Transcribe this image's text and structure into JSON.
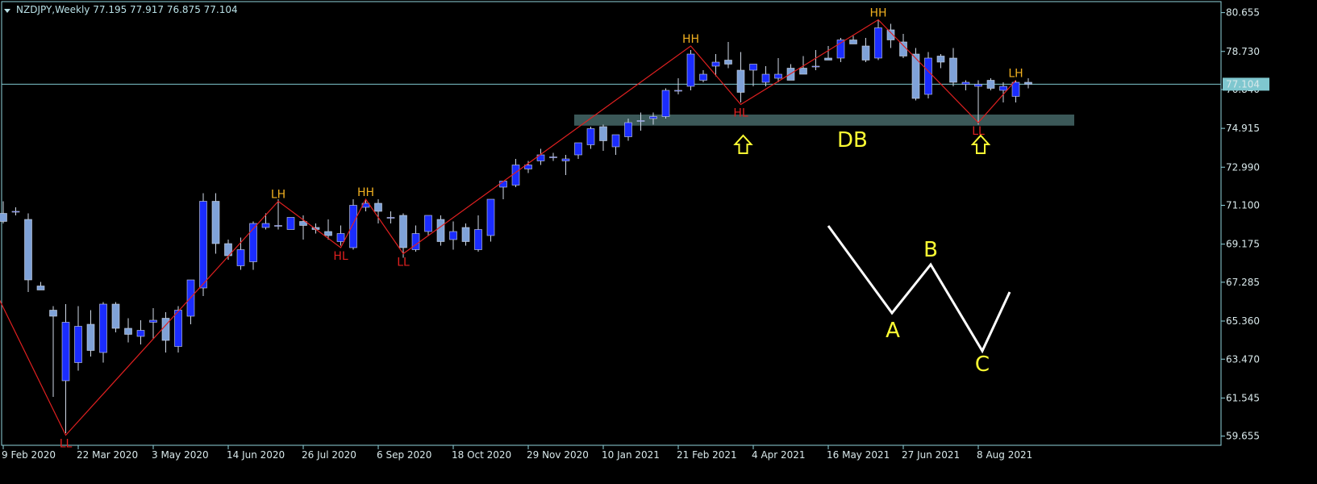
{
  "header": {
    "symbol": "NZDJPY,Weekly",
    "ohlc": "77.195 77.917 76.875 77.104"
  },
  "colors": {
    "background": "#000000",
    "bull_candle": "#1a2cff",
    "bear_candle": "#7fa2d8",
    "zigzag": "#e02020",
    "zone": "#3b5858",
    "axis": "#8fd3dd",
    "price_line": "#7fc7cf",
    "label_high": "#f0b020",
    "label_low": "#e02020",
    "pattern": "#ffffff",
    "annotation": "#ffff33"
  },
  "chart_data": {
    "type": "candlestick",
    "title": "NZDJPY,Weekly",
    "timeframe": "Weekly",
    "current_price": "77.104",
    "ylim": [
      59.2,
      81.2
    ],
    "y_ticks": [
      "80.655",
      "78.730",
      "76.840",
      "74.915",
      "72.990",
      "71.100",
      "69.175",
      "67.285",
      "65.360",
      "63.470",
      "61.545",
      "59.655"
    ],
    "x_ticks": [
      "9 Feb 2020",
      "22 Mar 2020",
      "3 May 2020",
      "14 Jun 2020",
      "26 Jul 2020",
      "6 Sep 2020",
      "18 Oct 2020",
      "29 Nov 2020",
      "10 Jan 2021",
      "21 Feb 2021",
      "4 Apr 2021",
      "16 May 2021",
      "27 Jun 2021",
      "8 Aug 2021"
    ],
    "candles": [
      {
        "o": 70.7,
        "h": 71.3,
        "l": 70.2,
        "c": 70.3
      },
      {
        "o": 70.8,
        "h": 71.0,
        "l": 70.6,
        "c": 70.8
      },
      {
        "o": 70.4,
        "h": 70.7,
        "l": 66.8,
        "c": 67.4
      },
      {
        "o": 67.1,
        "h": 67.3,
        "l": 66.9,
        "c": 66.9
      },
      {
        "o": 65.9,
        "h": 66.1,
        "l": 61.6,
        "c": 65.6
      },
      {
        "o": 62.4,
        "h": 66.2,
        "l": 59.8,
        "c": 65.3
      },
      {
        "o": 63.3,
        "h": 66.1,
        "l": 62.9,
        "c": 65.1
      },
      {
        "o": 65.2,
        "h": 65.9,
        "l": 63.6,
        "c": 63.9
      },
      {
        "o": 63.8,
        "h": 66.3,
        "l": 63.3,
        "c": 66.2
      },
      {
        "o": 66.2,
        "h": 66.3,
        "l": 64.8,
        "c": 65.0
      },
      {
        "o": 65.0,
        "h": 65.5,
        "l": 64.3,
        "c": 64.7
      },
      {
        "o": 64.6,
        "h": 65.4,
        "l": 64.2,
        "c": 64.9
      },
      {
        "o": 65.3,
        "h": 66.0,
        "l": 64.5,
        "c": 65.4
      },
      {
        "o": 65.5,
        "h": 65.8,
        "l": 63.8,
        "c": 64.4
      },
      {
        "o": 64.1,
        "h": 66.1,
        "l": 63.8,
        "c": 65.9
      },
      {
        "o": 65.6,
        "h": 67.4,
        "l": 65.2,
        "c": 67.4
      },
      {
        "o": 67.0,
        "h": 71.7,
        "l": 66.6,
        "c": 71.3
      },
      {
        "o": 71.3,
        "h": 71.7,
        "l": 68.7,
        "c": 69.2
      },
      {
        "o": 69.2,
        "h": 69.4,
        "l": 68.4,
        "c": 68.6
      },
      {
        "o": 68.1,
        "h": 69.5,
        "l": 67.9,
        "c": 68.9
      },
      {
        "o": 68.3,
        "h": 70.3,
        "l": 67.9,
        "c": 70.2
      },
      {
        "o": 70.0,
        "h": 70.7,
        "l": 69.9,
        "c": 70.2
      },
      {
        "o": 70.1,
        "h": 71.4,
        "l": 69.9,
        "c": 70.1
      },
      {
        "o": 69.9,
        "h": 70.5,
        "l": 69.9,
        "c": 70.5
      },
      {
        "o": 70.3,
        "h": 70.6,
        "l": 69.4,
        "c": 70.1
      },
      {
        "o": 70.0,
        "h": 70.2,
        "l": 69.7,
        "c": 69.9
      },
      {
        "o": 69.8,
        "h": 70.4,
        "l": 69.4,
        "c": 69.6
      },
      {
        "o": 69.3,
        "h": 70.1,
        "l": 69.1,
        "c": 69.7
      },
      {
        "o": 69.0,
        "h": 71.4,
        "l": 68.9,
        "c": 71.1
      },
      {
        "o": 71.0,
        "h": 71.4,
        "l": 70.8,
        "c": 71.2
      },
      {
        "o": 71.2,
        "h": 71.4,
        "l": 70.2,
        "c": 70.8
      },
      {
        "o": 70.5,
        "h": 70.8,
        "l": 70.2,
        "c": 70.5
      },
      {
        "o": 70.6,
        "h": 70.7,
        "l": 68.5,
        "c": 69.0
      },
      {
        "o": 68.9,
        "h": 70.1,
        "l": 68.8,
        "c": 69.7
      },
      {
        "o": 69.8,
        "h": 70.6,
        "l": 69.6,
        "c": 70.6
      },
      {
        "o": 70.4,
        "h": 70.6,
        "l": 69.1,
        "c": 69.3
      },
      {
        "o": 69.4,
        "h": 70.3,
        "l": 68.9,
        "c": 69.8
      },
      {
        "o": 70.0,
        "h": 70.2,
        "l": 69.1,
        "c": 69.3
      },
      {
        "o": 68.9,
        "h": 70.6,
        "l": 68.8,
        "c": 69.9
      },
      {
        "o": 69.6,
        "h": 71.4,
        "l": 69.3,
        "c": 71.4
      },
      {
        "o": 72.0,
        "h": 72.3,
        "l": 71.4,
        "c": 72.3
      },
      {
        "o": 72.1,
        "h": 73.4,
        "l": 72.0,
        "c": 73.1
      },
      {
        "o": 72.9,
        "h": 73.3,
        "l": 72.7,
        "c": 73.1
      },
      {
        "o": 73.3,
        "h": 73.9,
        "l": 73.1,
        "c": 73.6
      },
      {
        "o": 73.5,
        "h": 73.7,
        "l": 73.3,
        "c": 73.5
      },
      {
        "o": 73.3,
        "h": 73.6,
        "l": 72.6,
        "c": 73.4
      },
      {
        "o": 73.6,
        "h": 74.2,
        "l": 73.4,
        "c": 74.2
      },
      {
        "o": 74.1,
        "h": 75.0,
        "l": 73.9,
        "c": 74.9
      },
      {
        "o": 75.0,
        "h": 75.1,
        "l": 73.8,
        "c": 74.3
      },
      {
        "o": 74.0,
        "h": 74.6,
        "l": 73.6,
        "c": 74.6
      },
      {
        "o": 74.5,
        "h": 75.4,
        "l": 74.3,
        "c": 75.2
      },
      {
        "o": 75.3,
        "h": 75.7,
        "l": 74.8,
        "c": 75.3
      },
      {
        "o": 75.4,
        "h": 75.7,
        "l": 75.1,
        "c": 75.5
      },
      {
        "o": 75.5,
        "h": 76.9,
        "l": 75.4,
        "c": 76.8
      },
      {
        "o": 76.8,
        "h": 77.4,
        "l": 76.6,
        "c": 76.8
      },
      {
        "o": 77.0,
        "h": 78.8,
        "l": 76.8,
        "c": 78.6
      },
      {
        "o": 77.3,
        "h": 77.8,
        "l": 77.2,
        "c": 77.6
      },
      {
        "o": 78.0,
        "h": 78.6,
        "l": 77.5,
        "c": 78.2
      },
      {
        "o": 78.3,
        "h": 79.2,
        "l": 77.9,
        "c": 78.1
      },
      {
        "o": 77.8,
        "h": 78.7,
        "l": 76.2,
        "c": 76.7
      },
      {
        "o": 77.8,
        "h": 78.0,
        "l": 77.0,
        "c": 78.1
      },
      {
        "o": 77.2,
        "h": 78.0,
        "l": 77.0,
        "c": 77.6
      },
      {
        "o": 77.4,
        "h": 78.4,
        "l": 77.2,
        "c": 77.6
      },
      {
        "o": 77.9,
        "h": 78.1,
        "l": 77.4,
        "c": 77.3
      },
      {
        "o": 77.9,
        "h": 78.5,
        "l": 77.6,
        "c": 77.6
      },
      {
        "o": 78.0,
        "h": 78.8,
        "l": 77.8,
        "c": 78.0
      },
      {
        "o": 78.4,
        "h": 79.0,
        "l": 78.3,
        "c": 78.3
      },
      {
        "o": 78.4,
        "h": 79.4,
        "l": 78.2,
        "c": 79.3
      },
      {
        "o": 79.3,
        "h": 79.5,
        "l": 79.1,
        "c": 79.1
      },
      {
        "o": 79.0,
        "h": 79.4,
        "l": 78.2,
        "c": 78.3
      },
      {
        "o": 78.4,
        "h": 80.3,
        "l": 78.3,
        "c": 79.9
      },
      {
        "o": 79.8,
        "h": 80.1,
        "l": 78.9,
        "c": 79.3
      },
      {
        "o": 79.2,
        "h": 79.6,
        "l": 78.4,
        "c": 78.5
      },
      {
        "o": 78.6,
        "h": 78.9,
        "l": 76.3,
        "c": 76.4
      },
      {
        "o": 76.6,
        "h": 78.7,
        "l": 76.4,
        "c": 78.4
      },
      {
        "o": 78.5,
        "h": 78.6,
        "l": 77.9,
        "c": 78.2
      },
      {
        "o": 78.4,
        "h": 78.9,
        "l": 77.0,
        "c": 77.2
      },
      {
        "o": 77.1,
        "h": 77.3,
        "l": 76.8,
        "c": 77.2
      },
      {
        "o": 77.0,
        "h": 77.3,
        "l": 75.1,
        "c": 77.1
      },
      {
        "o": 77.3,
        "h": 77.4,
        "l": 76.8,
        "c": 76.9
      },
      {
        "o": 76.8,
        "h": 77.2,
        "l": 76.2,
        "c": 77.0
      },
      {
        "o": 76.5,
        "h": 77.3,
        "l": 76.2,
        "c": 77.2
      },
      {
        "o": 77.2,
        "h": 77.4,
        "l": 76.9,
        "c": 77.1
      }
    ],
    "zigzag": [
      {
        "index": -1,
        "price": 67.3
      },
      {
        "index": 5,
        "price": 59.7
      },
      {
        "index": 22,
        "price": 71.3
      },
      {
        "index": 27,
        "price": 69.0
      },
      {
        "index": 29,
        "price": 71.4
      },
      {
        "index": 32,
        "price": 68.7
      },
      {
        "index": 55,
        "price": 79.0
      },
      {
        "index": 59,
        "price": 76.1
      },
      {
        "index": 70,
        "price": 80.3
      },
      {
        "index": 78,
        "price": 75.2
      },
      {
        "index": 81,
        "price": 77.3
      }
    ],
    "swing_labels": [
      {
        "text": "LL",
        "index": 5,
        "price": 59.7,
        "kind": "low"
      },
      {
        "text": "LH",
        "index": 22,
        "price": 71.3,
        "kind": "high"
      },
      {
        "text": "HL",
        "index": 27,
        "price": 69.0,
        "kind": "low"
      },
      {
        "text": "HH",
        "index": 29,
        "price": 71.4,
        "kind": "high"
      },
      {
        "text": "LL",
        "index": 32,
        "price": 68.7,
        "kind": "low"
      },
      {
        "text": "HH",
        "index": 55,
        "price": 79.0,
        "kind": "high"
      },
      {
        "text": "HL",
        "index": 59,
        "price": 76.1,
        "kind": "low"
      },
      {
        "text": "HH",
        "index": 70,
        "price": 80.3,
        "kind": "high"
      },
      {
        "text": "LL",
        "index": 78,
        "price": 75.2,
        "kind": "low"
      },
      {
        "text": "LH",
        "index": 81,
        "price": 77.3,
        "kind": "high"
      }
    ],
    "zone": {
      "from_index": 46,
      "to_index": 86,
      "low": 75.05,
      "high": 75.6
    },
    "annotation_text": "DB",
    "pattern_points": [
      "A",
      "B",
      "C"
    ]
  }
}
